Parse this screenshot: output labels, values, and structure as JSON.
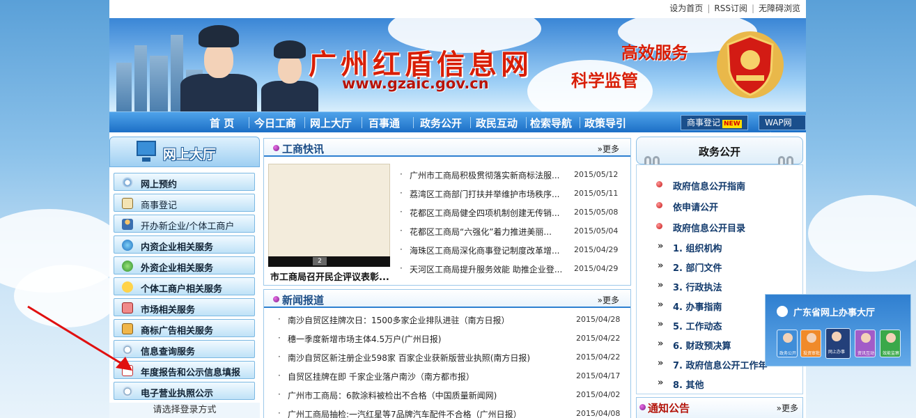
{
  "topbar": {
    "links": [
      "设为首页",
      "RSS订阅",
      "无障碍浏览"
    ]
  },
  "banner": {
    "site_title": "广州红盾信息网",
    "site_url": "www.gzaic.gov.cn",
    "slogan1": "高效服务",
    "slogan2": "科学监管"
  },
  "nav": {
    "items": [
      "首 页",
      "今日工商",
      "网上大厅",
      "百事通",
      "政务公开",
      "政民互动",
      "检索导航",
      "政策导引"
    ],
    "btn_registration": "商事登记",
    "new_badge": "NEW",
    "btn_wap": "WAP网站"
  },
  "left": {
    "title": "网上大厅",
    "services": [
      {
        "label": "网上预约",
        "icon": "compass-icon"
      },
      {
        "label": "商事登记",
        "icon": "clipboard-icon"
      },
      {
        "label": "开办新企业/个体工商户",
        "icon": "person-icon"
      },
      {
        "label": "内资企业相关服务",
        "icon": "globe-icon"
      },
      {
        "label": "外资企业相关服务",
        "icon": "globe-arrow-icon"
      },
      {
        "label": "个体工商户相关服务",
        "icon": "runner-icon"
      },
      {
        "label": "市场相关服务",
        "icon": "shop-icon"
      },
      {
        "label": "商标广告相关服务",
        "icon": "documents-icon"
      },
      {
        "label": "信息查询服务",
        "icon": "magnifier-icon"
      },
      {
        "label": "年度报告和公示信息填报",
        "icon": "report-icon"
      },
      {
        "label": "电子营业执照公示",
        "icon": "magnifier-icon"
      }
    ],
    "login_tip": "请选择登录方式"
  },
  "center": {
    "news_flash": {
      "title": "工商快讯",
      "more": "»更多",
      "photo_caption": "市工商局召开民企评议表彰...",
      "photo_index": "2",
      "items": [
        {
          "title": "广州市工商局积极贯彻落实新商标法服...",
          "date": "2015/05/12"
        },
        {
          "title": "荔湾区工商部门打扶并举维护市场秩序...",
          "date": "2015/05/11"
        },
        {
          "title": "花都区工商局健全四项机制创建无传销...",
          "date": "2015/05/08"
        },
        {
          "title": "花都区工商局“六强化”着力推进美丽...",
          "date": "2015/05/04"
        },
        {
          "title": "海珠区工商局深化商事登记制度改革增...",
          "date": "2015/04/29"
        },
        {
          "title": "天河区工商局提升服务效能 助推企业登...",
          "date": "2015/04/29"
        }
      ]
    },
    "news_report": {
      "title": "新闻报道",
      "more": "»更多",
      "items": [
        {
          "title": "南沙自贸区挂牌次日：1500多家企业排队进驻（南方日报）",
          "date": "2015/04/28"
        },
        {
          "title": "穗一季度新增市场主体4.5万户(广州日报)",
          "date": "2015/04/22"
        },
        {
          "title": "南沙自贸区新注册企业598家 百家企业获新版营业执照(南方日报)",
          "date": "2015/04/22"
        },
        {
          "title": "自贸区挂牌在即 千家企业落户南沙（南方都市报）",
          "date": "2015/04/17"
        },
        {
          "title": "广州市工商局：6款涂料被检出不合格（中国质量新闻网)",
          "date": "2015/04/02"
        },
        {
          "title": "广州工商局抽检:一汽红星等7品牌汽车配件不合格（广州日报）",
          "date": "2015/04/08"
        }
      ]
    }
  },
  "right": {
    "title": "政务公开",
    "items": [
      "政府信息公开指南",
      "依申请公开",
      "政府信息公开目录"
    ],
    "subitems": [
      "1. 组织机构",
      "2. 部门文件",
      "3. 行政执法",
      "4. 办事指南",
      "5. 工作动态",
      "6. 财政预决算",
      "7. 政府信息公开工作年",
      "8. 其他"
    ],
    "notice_title": "通知公告",
    "notice_more": "»更多"
  },
  "float_widget": {
    "title": "广东省网上办事大厅",
    "icons": [
      "政务公开",
      "投资审批",
      "网上办事",
      "资讯互动",
      "效能监察"
    ]
  },
  "colors": {
    "nav_blue": "#1c6fc6",
    "title_red": "#d81e06",
    "link_navy": "#123a6c"
  }
}
